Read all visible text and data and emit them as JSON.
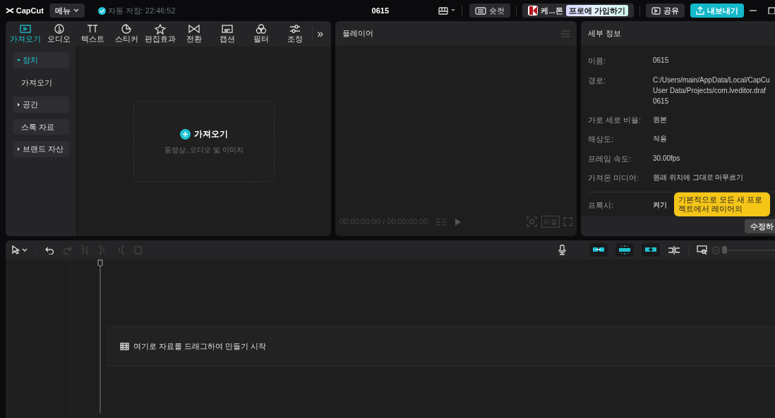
{
  "topbar": {
    "logo": "CapCut",
    "menu": "메뉴",
    "autosave": "자동 저장: 22:46:52",
    "title": "0615",
    "shortcut": "숏컷",
    "account": "케...톤",
    "pro": "프로에 가입하기",
    "share": "공유",
    "export": "내보내기"
  },
  "tabs": [
    {
      "label": "가져오기",
      "selected": true
    },
    {
      "label": "오디오",
      "selected": false
    },
    {
      "label": "텍스트",
      "selected": false
    },
    {
      "label": "스티커",
      "selected": false
    },
    {
      "label": "편집효과",
      "selected": false
    },
    {
      "label": "전환",
      "selected": false
    },
    {
      "label": "캡션",
      "selected": false
    },
    {
      "label": "필터",
      "selected": false
    },
    {
      "label": "조정",
      "selected": false
    }
  ],
  "more_tabs": "»",
  "sidebar": [
    {
      "label": "장치",
      "kind": "group",
      "expanded": true,
      "selected": true
    },
    {
      "label": "가져오기",
      "kind": "item",
      "selected": false
    },
    {
      "label": "공간",
      "kind": "group",
      "expanded": false,
      "selected": false
    },
    {
      "label": "스톡 자료",
      "kind": "button",
      "selected": false
    },
    {
      "label": "브랜드 자산",
      "kind": "group",
      "expanded": false,
      "selected": false
    }
  ],
  "import": {
    "title": "가져오기",
    "hint": "동영상, 오디오 및 이미지"
  },
  "player": {
    "title": "플레이어",
    "timecode": "00:00:00:00 / 00:00:00:00",
    "ratio": "비율"
  },
  "details": {
    "title": "세부 정보",
    "rows": [
      {
        "label": "이름:",
        "value": [
          "0615"
        ]
      },
      {
        "label": "경로:",
        "value": [
          "C:/Users/main/AppData/Local/CapCu",
          "User Data/Projects/com.lveditor.draf",
          "0615"
        ]
      },
      {
        "label": "가로 세로 비율:",
        "value": [
          "원본"
        ]
      },
      {
        "label": "해상도:",
        "value": [
          "적용"
        ]
      },
      {
        "label": "프레임 속도:",
        "value": [
          "30.00fps"
        ]
      },
      {
        "label": "가져온 미디어:",
        "value": [
          "원래 위치에 그대로 머무르기"
        ]
      }
    ],
    "proxy": {
      "label": "프록시:",
      "value": "켜기",
      "tooltip": "기본적으로 모든 새 프로젝트에서 레이어의"
    },
    "edit": "수정하"
  },
  "timeline": {
    "toggles": [
      {
        "on": true
      },
      {
        "on": true
      },
      {
        "on": true
      }
    ],
    "zoom": {
      "level": 0.0
    },
    "hint": "여기로 자료를 드래그하여 만들기 시작"
  }
}
